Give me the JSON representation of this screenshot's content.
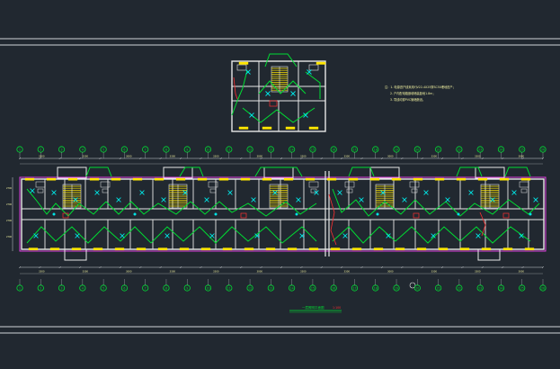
{
  "drawing": {
    "background": "#212830",
    "colors": {
      "frame": "#d0d4d8",
      "wall": "#e8e8e8",
      "wiring": "#00dd33",
      "fixture": "#00e5e5",
      "boundary": "#e040e0",
      "accent": "#ff3030",
      "equipment": "#ffe600",
      "dim_text": "#f0f0a0",
      "grid_bubble": "#00dd33"
    },
    "notes": [
      "注：1. 电源进户线采用YJV22-4X25穿SC50埋地进户；",
      "2. 户内配电箱嵌墙暗装距地1.8m；",
      "3. 导线均穿PVC管暗敷设。"
    ],
    "title_main": "一层照明平面图",
    "title_scale": "1:100",
    "grid_top": [
      "1",
      "2",
      "3",
      "4",
      "5",
      "6",
      "7",
      "8",
      "9",
      "10",
      "11",
      "12",
      "13",
      "14",
      "15",
      "16",
      "17",
      "18",
      "19",
      "20",
      "21",
      "22",
      "23",
      "24",
      "25",
      "26"
    ],
    "grid_bottom": [
      "1",
      "2",
      "3",
      "4",
      "5",
      "6",
      "7",
      "8",
      "9",
      "10",
      "11",
      "12",
      "13",
      "14",
      "15",
      "16",
      "17",
      "18",
      "19",
      "20",
      "21",
      "22",
      "23",
      "24",
      "25",
      "26"
    ],
    "dim_labels_top": [
      "3300",
      "3300",
      "3000",
      "3300",
      "3300",
      "3000",
      "3300",
      "3300",
      "3000",
      "3300",
      "3300",
      "3000"
    ],
    "dim_labels_bottom": [
      "3300",
      "3300",
      "3000",
      "3300",
      "3300",
      "3000",
      "3300",
      "3300",
      "3000",
      "3300",
      "3300",
      "3000"
    ],
    "room_dims": [
      "2700",
      "2700",
      "2700",
      "2700"
    ]
  }
}
